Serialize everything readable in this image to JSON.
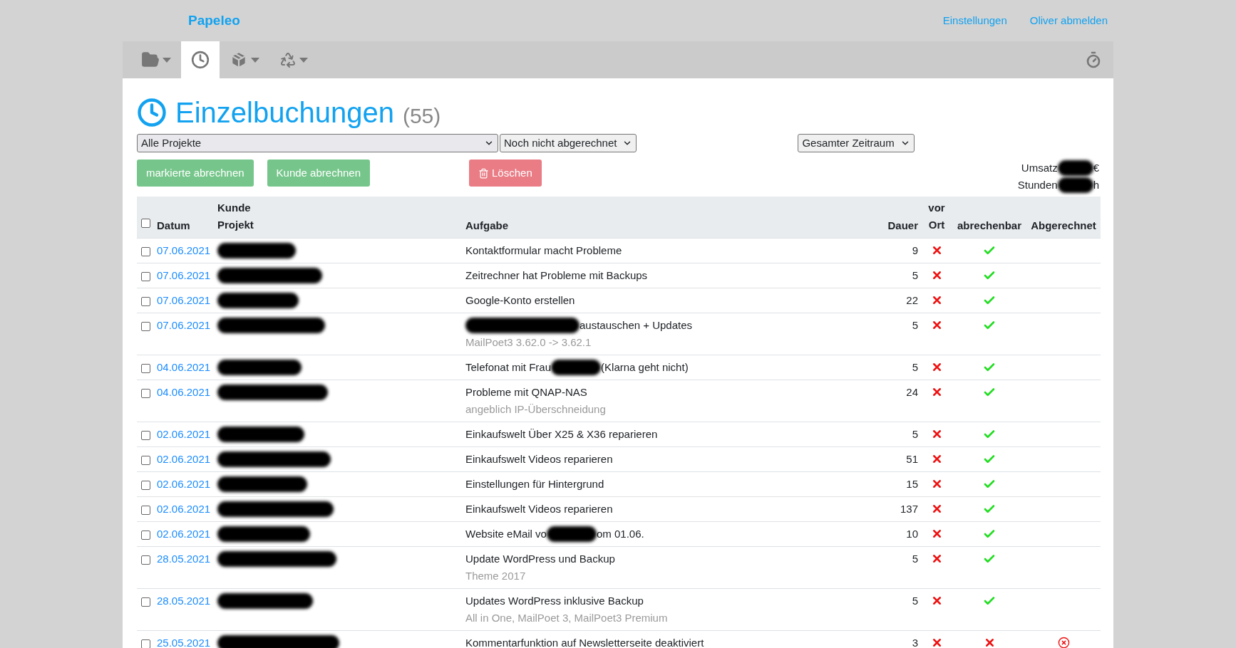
{
  "brand": "Papeleo",
  "top_links": [
    "Einstellungen",
    "Oliver abmelden"
  ],
  "toolbar": {
    "tabs": [
      {
        "kind": "folder",
        "selected": false,
        "dropdown": true
      },
      {
        "kind": "clock",
        "selected": true,
        "dropdown": false
      },
      {
        "kind": "box",
        "selected": false,
        "dropdown": true
      },
      {
        "kind": "recycle",
        "selected": false,
        "dropdown": true
      }
    ]
  },
  "title": "Einzelbuchungen",
  "count": "(55)",
  "filters": [
    {
      "value": "Alle Projekte",
      "kind": "wide"
    },
    {
      "value": "Noch nicht abgerechnet",
      "kind": "normal"
    },
    {
      "value": "Gesamter Zeitraum",
      "kind": "normal"
    }
  ],
  "buttons": [
    {
      "label": "markierte abrechnen",
      "kind": "success"
    },
    {
      "label": "Kunde abrechnen",
      "kind": "success"
    },
    {
      "label": "Löschen",
      "kind": "danger"
    }
  ],
  "summary": [
    {
      "label": "Umsatz",
      "unit": "€"
    },
    {
      "label": "Stunden",
      "unit": "h"
    }
  ],
  "table": {
    "columns": {
      "select_all": false,
      "date": "Datum",
      "customer": "Kunde",
      "project": "Projekt",
      "task": "Aufgabe",
      "duration": "Dauer",
      "onsite_1": "vor",
      "onsite_2": "Ort",
      "billable": "abrechenbar",
      "billed": "Abgerechnet"
    },
    "rows": [
      {
        "checked": false,
        "date": "07.06.2021",
        "task": [
          {
            "kind": "text",
            "text": "Kontaktformular macht Probleme"
          }
        ],
        "duration": "9",
        "onsite": false,
        "billable": true,
        "billed_marker": false
      },
      {
        "checked": false,
        "date": "07.06.2021",
        "task": [
          {
            "kind": "text",
            "text": "Zeitrechner hat Probleme mit Backups"
          }
        ],
        "duration": "5",
        "onsite": false,
        "billable": true,
        "billed_marker": false
      },
      {
        "checked": false,
        "date": "07.06.2021",
        "task": [
          {
            "kind": "text",
            "text": "Google-Konto erstellen"
          }
        ],
        "duration": "22",
        "onsite": false,
        "billable": true,
        "billed_marker": false
      },
      {
        "checked": false,
        "date": "07.06.2021",
        "task": [
          {
            "kind": "redacted"
          },
          {
            "kind": "text",
            "text": "austauschen + Updates"
          }
        ],
        "note": "MailPoet3 3.62.0 -> 3.62.1",
        "duration": "5",
        "onsite": false,
        "billable": true,
        "billed_marker": false
      },
      {
        "checked": false,
        "date": "04.06.2021",
        "task": [
          {
            "kind": "text",
            "text": "Telefonat mit Frau"
          },
          {
            "kind": "redacted"
          },
          {
            "kind": "text",
            "text": "(Klarna geht nicht)"
          }
        ],
        "duration": "5",
        "onsite": false,
        "billable": true,
        "billed_marker": false
      },
      {
        "checked": false,
        "date": "04.06.2021",
        "task": [
          {
            "kind": "text",
            "text": "Probleme mit QNAP-NAS"
          }
        ],
        "note": "angeblich IP-Überschneidung",
        "duration": "24",
        "onsite": false,
        "billable": true,
        "billed_marker": false
      },
      {
        "checked": false,
        "date": "02.06.2021",
        "task": [
          {
            "kind": "text",
            "text": "Einkaufswelt Über X25 & X36 reparieren"
          }
        ],
        "duration": "5",
        "onsite": false,
        "billable": true,
        "billed_marker": false
      },
      {
        "checked": false,
        "date": "02.06.2021",
        "task": [
          {
            "kind": "text",
            "text": "Einkaufswelt Videos reparieren"
          }
        ],
        "duration": "51",
        "onsite": false,
        "billable": true,
        "billed_marker": false
      },
      {
        "checked": false,
        "date": "02.06.2021",
        "task": [
          {
            "kind": "text",
            "text": "Einstellungen für Hintergrund"
          }
        ],
        "duration": "15",
        "onsite": false,
        "billable": true,
        "billed_marker": false
      },
      {
        "checked": false,
        "date": "02.06.2021",
        "task": [
          {
            "kind": "text",
            "text": "Einkaufswelt Videos reparieren"
          }
        ],
        "duration": "137",
        "onsite": false,
        "billable": true,
        "billed_marker": false
      },
      {
        "checked": false,
        "date": "02.06.2021",
        "task": [
          {
            "kind": "text",
            "text": "Website eMail vo"
          },
          {
            "kind": "redacted"
          },
          {
            "kind": "text",
            "text": "om 01.06."
          }
        ],
        "duration": "10",
        "onsite": false,
        "billable": true,
        "billed_marker": false
      },
      {
        "checked": false,
        "date": "28.05.2021",
        "task": [
          {
            "kind": "text",
            "text": "Update WordPress und Backup"
          }
        ],
        "note": "Theme 2017",
        "duration": "5",
        "onsite": false,
        "billable": true,
        "billed_marker": false
      },
      {
        "checked": false,
        "date": "28.05.2021",
        "task": [
          {
            "kind": "text",
            "text": "Updates WordPress inklusive Backup"
          }
        ],
        "note": "All in One, MailPoet 3, MailPoet3 Premium",
        "duration": "5",
        "onsite": false,
        "billable": true,
        "billed_marker": false
      },
      {
        "checked": false,
        "date": "25.05.2021",
        "task": [
          {
            "kind": "text",
            "text": "Kommentarfunktion auf Newsletterseite deaktiviert"
          }
        ],
        "duration": "3",
        "onsite": false,
        "billable": false,
        "billed_marker": true
      }
    ]
  }
}
